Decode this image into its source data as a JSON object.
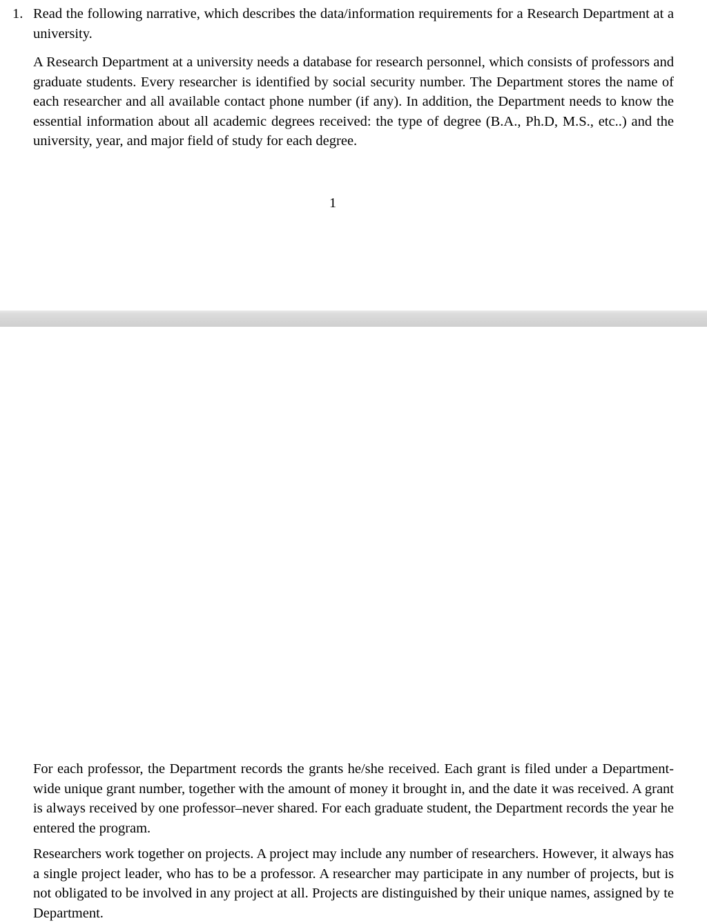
{
  "document": {
    "type": "scanned-exam-document",
    "pages": [
      {
        "page_number": "1",
        "items": [
          {
            "marker": "1.",
            "text": "Read the following narrative, which describes the data/information requirements for a Research Department at a university."
          }
        ],
        "paragraphs": [
          "A Research Department at a university needs a database for research personnel, which consists of professors and graduate students. Every researcher is identified by social security number. The Department stores the name of each researcher and all available contact phone number (if any). In addition, the Department needs to know the essential information about all academic degrees received: the type of degree (B.A., Ph.D, M.S., etc..) and the university, year, and major field of study for each degree."
        ]
      },
      {
        "paragraphs": [
          "For each professor, the Department records the grants he/she received. Each grant is filed under a Department-wide unique grant number, together with the amount of money it brought in, and the date it was received. A grant is always received by one professor–never shared. For each graduate student, the Department records the year he entered the program.",
          "Researchers work together on projects. A project may include any number of researchers. However, it always has a single project leader, who has to be a professor. A researcher may participate in any number of projects, but is not obligated to be involved in any project at all. Projects are distinguished by their unique names, assigned by te Department."
        ]
      }
    ]
  },
  "colors": {
    "page_background": "#ffffff",
    "text": "#000000",
    "separator_top": "#e9e9e9",
    "separator_bottom": "#cfcfcf"
  }
}
